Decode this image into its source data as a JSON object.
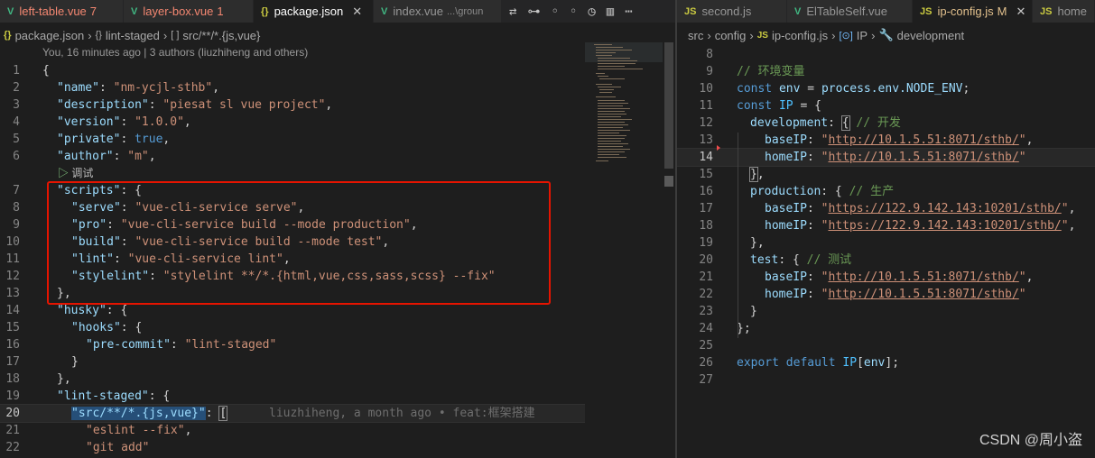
{
  "tabs_left": [
    {
      "icon": "V",
      "name": "left-table.vue",
      "badge": "7",
      "color": "red",
      "active": false
    },
    {
      "icon": "V",
      "name": "layer-box.vue",
      "badge": "1",
      "color": "red",
      "active": false
    },
    {
      "icon": "{}",
      "name": "package.json",
      "badge": "",
      "color": "white",
      "active": true
    },
    {
      "icon": "V",
      "name": "index.vue",
      "badge": "...\\groun",
      "color": "grey",
      "active": false
    }
  ],
  "tabs_right": [
    {
      "icon": "JS",
      "name": "second.js",
      "badge": "",
      "active": false
    },
    {
      "icon": "V",
      "name": "ElTableSelf.vue",
      "badge": "",
      "active": false
    },
    {
      "icon": "JS",
      "name": "ip-config.js",
      "badge": "M",
      "active": true
    },
    {
      "icon": "JS",
      "name": "home",
      "badge": "",
      "active": false
    }
  ],
  "breadcrumb_left": [
    "package.json",
    "lint-staged",
    "src/**/*.{js,vue}"
  ],
  "breadcrumb_right": [
    "src",
    "config",
    "ip-config.js",
    "IP",
    "development"
  ],
  "blame_header": "You, 16 minutes ago | 3 authors (liuzhiheng and others)",
  "debug_lens": "调试",
  "inline_blame": "liuzhiheng, a month ago • feat:框架搭建",
  "watermark": "CSDN @周小盗",
  "left_code": {
    "n1": "1",
    "n2": "2",
    "n3": "3",
    "n4": "4",
    "n5": "5",
    "n6": "6",
    "n7": "7",
    "n8": "8",
    "n9": "9",
    "n10": "10",
    "n11": "11",
    "n12": "12",
    "n13": "13",
    "n14": "14",
    "n15": "15",
    "n16": "16",
    "n17": "17",
    "n18": "18",
    "n19": "19",
    "n20": "20",
    "n21": "21",
    "n22": "22",
    "name_k": "\"name\"",
    "name_v": "\"nm-ycjl-sthb\"",
    "desc_k": "\"description\"",
    "desc_v": "\"piesat sl vue project\"",
    "ver_k": "\"version\"",
    "ver_v": "\"1.0.0\"",
    "priv_k": "\"private\"",
    "priv_v": "true",
    "auth_k": "\"author\"",
    "auth_v": "\"m\"",
    "scripts_k": "\"scripts\"",
    "serve_k": "\"serve\"",
    "serve_v": "\"vue-cli-service serve\"",
    "pro_k": "\"pro\"",
    "pro_v": "\"vue-cli-service build --mode production\"",
    "build_k": "\"build\"",
    "build_v": "\"vue-cli-service build --mode test\"",
    "lint_k": "\"lint\"",
    "lint_v": "\"vue-cli-service lint\"",
    "style_k": "\"stylelint\"",
    "style_v": "\"stylelint **/*.{html,vue,css,sass,scss} --fix\"",
    "husky_k": "\"husky\"",
    "hooks_k": "\"hooks\"",
    "pre_k": "\"pre-commit\"",
    "pre_v": "\"lint-staged\"",
    "ls_k": "\"lint-staged\"",
    "src_k": "\"src/**/*.{js,vue}\"",
    "eslint_v": "\"eslint --fix\"",
    "git_v": "\"git add\""
  },
  "right_code": {
    "n8": "8",
    "n9": "9",
    "n10": "10",
    "n11": "11",
    "n12": "12",
    "n13": "13",
    "n14": "14",
    "n15": "15",
    "n16": "16",
    "n17": "17",
    "n18": "18",
    "n19": "19",
    "n20": "20",
    "n21": "21",
    "n22": "22",
    "n23": "23",
    "n24": "24",
    "n25": "25",
    "n26": "26",
    "n27": "27",
    "cmt_env": "// 环境变量",
    "kw_const": "const",
    "env_var": "env",
    "proc": "process.env.NODE_ENV",
    "ip_var": "IP",
    "dev_k": "development",
    "cmt_dev": "// 开发",
    "base_k": "baseIP",
    "home_k": "homeIP",
    "dev_url": "http://10.1.5.51:8071/sthb/",
    "prod_k": "production",
    "cmt_prod": "// 生产",
    "prod_url": "https://122.9.142.143:10201/sthb/",
    "test_k": "test",
    "cmt_test": "// 测试",
    "test_url": "http://10.1.5.51:8071/sthb/",
    "kw_export": "export",
    "kw_default": "default",
    "ip_env": "IP",
    "env_idx": "env"
  },
  "colors": {
    "highlight_box": "#e51400",
    "string": "#ce9178",
    "key": "#9cdcfe",
    "keyword": "#569cd6",
    "comment": "#6a9955"
  }
}
